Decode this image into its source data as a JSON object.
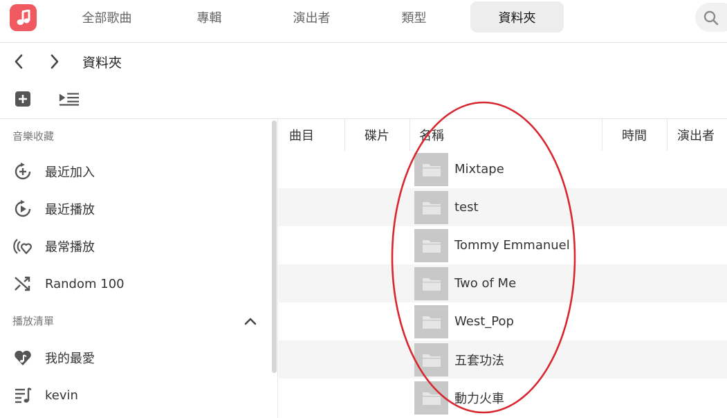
{
  "nav": {
    "tabs": [
      {
        "label": "全部歌曲"
      },
      {
        "label": "專輯"
      },
      {
        "label": "演出者"
      },
      {
        "label": "類型"
      },
      {
        "label": "資料夾"
      }
    ],
    "active_tab": "資料夾"
  },
  "breadcrumb": {
    "title": "資料夾"
  },
  "sidebar": {
    "library_title": "音樂收藏",
    "library_items": [
      {
        "label": "最近加入",
        "icon": "recently-added-icon"
      },
      {
        "label": "最近播放",
        "icon": "recently-played-icon"
      },
      {
        "label": "最常播放",
        "icon": "most-played-icon"
      },
      {
        "label": "Random 100",
        "icon": "shuffle-icon"
      }
    ],
    "playlists_title": "播放清單",
    "playlist_items": [
      {
        "label": "我的最愛",
        "icon": "heart-music-icon"
      },
      {
        "label": "kevin",
        "icon": "playlist-icon"
      }
    ]
  },
  "table": {
    "columns": [
      "曲目",
      "碟片",
      "名稱",
      "時間",
      "演出者"
    ],
    "rows": [
      {
        "name": "Mixtape"
      },
      {
        "name": "test"
      },
      {
        "name": "Tommy Emmanuel"
      },
      {
        "name": "Two of Me"
      },
      {
        "name": "West_Pop"
      },
      {
        "name": "五套功法"
      },
      {
        "name": "動力火車"
      }
    ]
  },
  "colors": {
    "brand": "#f0595f",
    "annotation": "#d8262f",
    "row_alt": "#f5f5f5",
    "folder_thumb": "#c8c8c8"
  }
}
